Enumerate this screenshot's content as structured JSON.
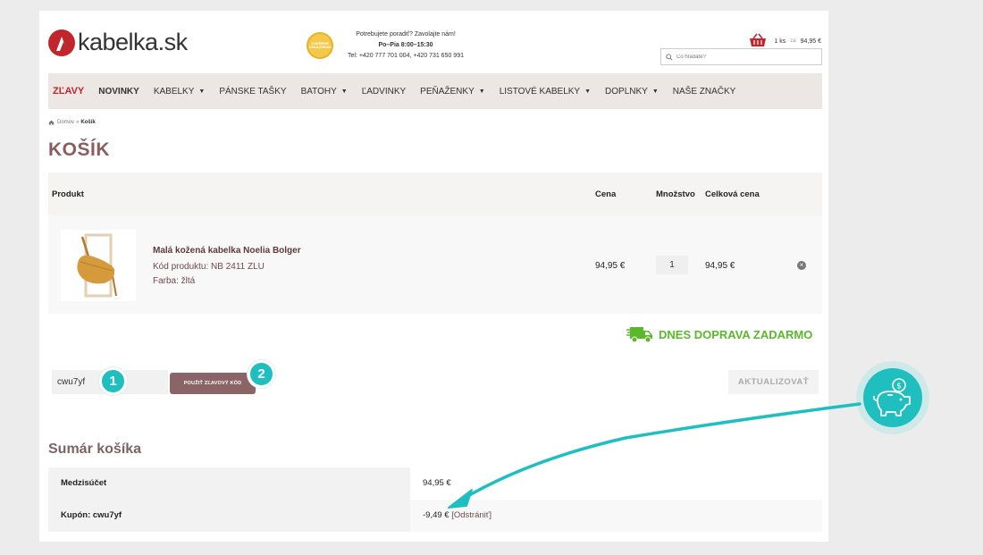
{
  "header": {
    "logo_text": "kabelka.sk",
    "badge_text": "OVERENÉ ZÁKAZNÍKMI",
    "contact_line1": "Potrebujete poradiť? Zavolajte nám!",
    "contact_hours": "Po–Pia 8:00–15:30",
    "contact_phones": "Tel: +420 777 701 004, +420 731 650 991",
    "cart_count": "1 ks",
    "cart_za": "za",
    "cart_total": "94,95 €",
    "search_placeholder": "Čo hľadáte?"
  },
  "nav": {
    "items": [
      {
        "label": "ZĽAVY"
      },
      {
        "label": "NOVINKY"
      },
      {
        "label": "KABELKY"
      },
      {
        "label": "PÁNSKE TAŠKY"
      },
      {
        "label": "BATOHY"
      },
      {
        "label": "ĽADVINKY"
      },
      {
        "label": "PEŇAŽENKY"
      },
      {
        "label": "LISTOVÉ KABELKY"
      },
      {
        "label": "DOPLNKY"
      },
      {
        "label": "NAŠE ZNAČKY"
      }
    ]
  },
  "breadcrumb": {
    "home": "Domov",
    "sep": "»",
    "current": "Košík"
  },
  "page_title": "KOŠÍK",
  "table": {
    "col_product": "Produkt",
    "col_price": "Cena",
    "col_qty": "Množstvo",
    "col_total": "Celková cena"
  },
  "item": {
    "name": "Malá kožená kabelka Noelia Bolger",
    "code": "Kód produktu: NB 2411 ZLU",
    "color": "Farba: žltá",
    "price": "94,95 €",
    "qty": "1",
    "total": "94,95 €",
    "remove_symbol": "×"
  },
  "shipping_text": "DNES DOPRAVA ZADARMO",
  "coupon": {
    "value": "cwu7yf",
    "apply_label": "POUŽIŤ ZĽAVOVÝ KÓD",
    "update_label": "AKTUALIZOVAŤ"
  },
  "steps": {
    "one": "1",
    "two": "2"
  },
  "summary": {
    "title": "Sumár košíka",
    "subtotal_label": "Medzisúčet",
    "subtotal_value": "94,95 €",
    "coupon_label": "Kupón: cwu7yf",
    "coupon_value": "-9,49 €",
    "coupon_remove": "[Odstrániť]"
  },
  "colors": {
    "brand_red": "#c0262c",
    "accent_mauve": "#8a5d5f",
    "teal": "#1fbfbf",
    "green": "#5bb82b"
  }
}
